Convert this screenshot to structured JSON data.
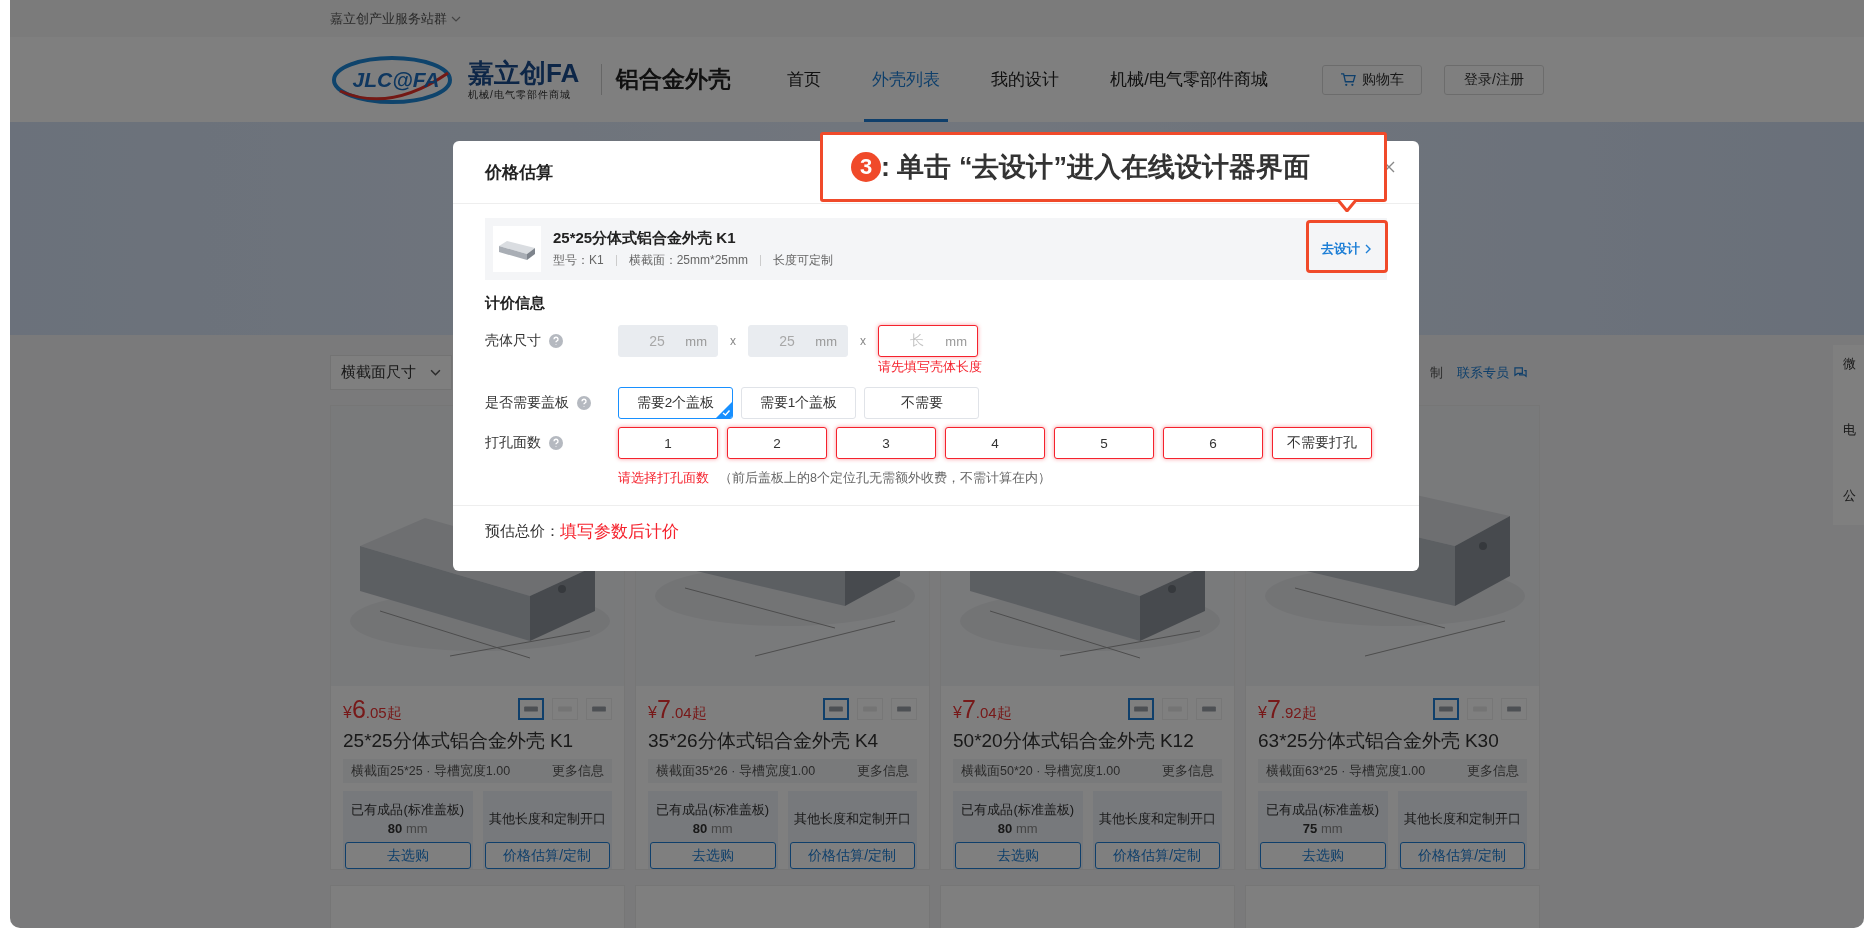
{
  "top_bar": {
    "label": "嘉立创产业服务站群"
  },
  "header": {
    "logo_mark": "JLC@FA",
    "brand": "嘉立创FA",
    "brand_sub": "机械/电气零部件商城",
    "product_line": "铝合金外壳",
    "nav": [
      {
        "label": "首页",
        "selected": false
      },
      {
        "label": "外壳列表",
        "selected": true
      },
      {
        "label": "我的设计",
        "selected": false
      },
      {
        "label": "机械/电气零部件商城",
        "selected": false
      }
    ],
    "cart_button": "购物车",
    "login_button": "登录/注册"
  },
  "filter_bar": {
    "select": "横截面尺寸",
    "partial_text": "制",
    "contact_link": "联系专员"
  },
  "side_panel": [
    "微",
    "电",
    "公"
  ],
  "products": [
    {
      "currency": "¥",
      "price_whole": "6",
      "price_rest": ".05起",
      "thumbs": [
        {
          "selected": true
        },
        {
          "selected": false
        },
        {
          "selected": false
        }
      ],
      "title": "25*25分体式铝合金外壳 K1",
      "spec": "横截面25*25 · 导槽宽度1.00",
      "more": "更多信息",
      "stock_label": "已有成品(标准盖板)",
      "stock_length": "80",
      "stock_unit": "mm",
      "buy_button": "去选购",
      "custom_label": "其他长度和定制开口",
      "custom_button": "价格估算/定制"
    },
    {
      "currency": "¥",
      "price_whole": "7",
      "price_rest": ".04起",
      "thumbs": [
        {
          "selected": true
        },
        {
          "selected": false
        },
        {
          "selected": false
        }
      ],
      "title": "35*26分体式铝合金外壳 K4",
      "spec": "横截面35*26 · 导槽宽度1.00",
      "more": "更多信息",
      "stock_label": "已有成品(标准盖板)",
      "stock_length": "80",
      "stock_unit": "mm",
      "buy_button": "去选购",
      "custom_label": "其他长度和定制开口",
      "custom_button": "价格估算/定制"
    },
    {
      "currency": "¥",
      "price_whole": "7",
      "price_rest": ".04起",
      "thumbs": [
        {
          "selected": true
        },
        {
          "selected": false
        },
        {
          "selected": false
        }
      ],
      "title": "50*20分体式铝合金外壳 K12",
      "spec": "横截面50*20 · 导槽宽度1.00",
      "more": "更多信息",
      "stock_label": "已有成品(标准盖板)",
      "stock_length": "80",
      "stock_unit": "mm",
      "buy_button": "去选购",
      "custom_label": "其他长度和定制开口",
      "custom_button": "价格估算/定制"
    },
    {
      "currency": "¥",
      "price_whole": "7",
      "price_rest": ".92起",
      "thumbs": [
        {
          "selected": true
        },
        {
          "selected": false
        },
        {
          "selected": false
        }
      ],
      "title": "63*25分体式铝合金外壳 K30",
      "spec": "横截面63*25 · 导槽宽度1.00",
      "more": "更多信息",
      "stock_label": "已有成品(标准盖板)",
      "stock_length": "75",
      "stock_unit": "mm",
      "buy_button": "去选购",
      "custom_label": "其他长度和定制开口",
      "custom_button": "价格估算/定制"
    }
  ],
  "modal": {
    "title": "价格估算",
    "product": {
      "name": "25*25分体式铝合金外壳 K1",
      "model": "型号：K1",
      "section": "横截面：25mm*25mm",
      "length": "长度可定制",
      "design_link": "去设计"
    },
    "section_title": "计价信息",
    "size": {
      "label": "壳体尺寸",
      "fields": [
        {
          "value": "25",
          "unit": "mm",
          "disabled": true,
          "error": false
        },
        {
          "value": "25",
          "unit": "mm",
          "disabled": true,
          "error": false
        },
        {
          "placeholder": "长",
          "unit": "mm",
          "disabled": false,
          "error": true
        }
      ],
      "separators": [
        "x",
        "x"
      ],
      "error": "请先填写壳体长度"
    },
    "cover": {
      "label": "是否需要盖板",
      "options": [
        {
          "label": "需要2个盖板",
          "selected": true
        },
        {
          "label": "需要1个盖板",
          "selected": false
        },
        {
          "label": "不需要",
          "selected": false
        }
      ]
    },
    "holes": {
      "label": "打孔面数",
      "options": [
        {
          "label": "1",
          "selected": false,
          "error": true
        },
        {
          "label": "2",
          "selected": false,
          "error": true
        },
        {
          "label": "3",
          "selected": false,
          "error": true
        },
        {
          "label": "4",
          "selected": false,
          "error": true
        },
        {
          "label": "5",
          "selected": false,
          "error": true
        },
        {
          "label": "6",
          "selected": false,
          "error": true
        },
        {
          "label": "不需要打孔",
          "selected": false,
          "error": true
        }
      ],
      "error": "请选择打孔面数",
      "note": "（前后盖板上的8个定位孔无需额外收费，不需计算在内）"
    },
    "total": {
      "label": "预估总价：",
      "value": "填写参数后计价"
    }
  },
  "annotation": {
    "number": "3",
    "text": ": 单击 “去设计”进入在线设计器界面"
  }
}
